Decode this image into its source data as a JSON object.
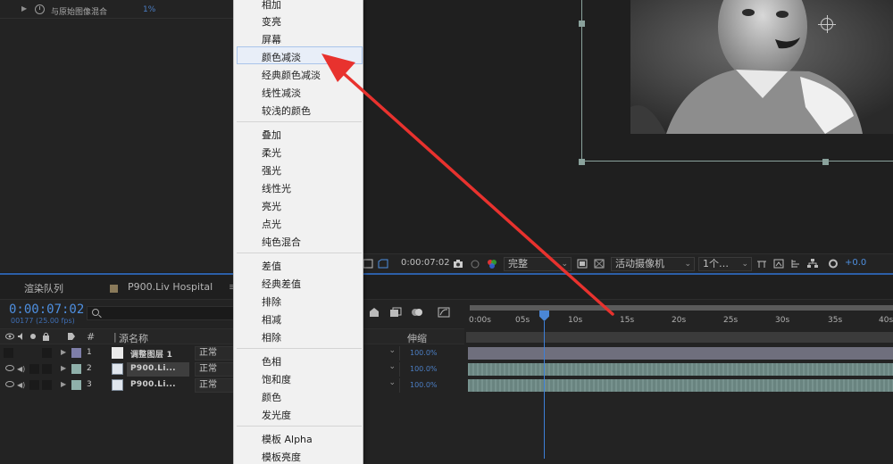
{
  "effects_panel": {
    "property_label": "与原始图像混合",
    "property_value": "1%"
  },
  "viewer_toolbar": {
    "timecode": "0:00:07:02",
    "resolution": "完整",
    "camera": "活动摄像机",
    "views": "1个…",
    "exposure": "+0.0"
  },
  "timeline": {
    "tabs": [
      "渲染队列",
      "P900.Liv Hospital"
    ],
    "timecode": "0:00:07:02",
    "frames": "00177 (25.00 fps)",
    "columns": {
      "hash": "#",
      "source_name": "源名称",
      "stretch": "伸缩"
    },
    "layers": [
      {
        "num": "1",
        "name": "调整图层 1",
        "mode": "正常",
        "stretch": "100.0%",
        "label_color": "#7e7ea8"
      },
      {
        "num": "2",
        "name": "P900.Li...",
        "mode": "正常",
        "stretch": "100.0%",
        "label_color": "#8fb0aa"
      },
      {
        "num": "3",
        "name": "P900.Li...",
        "mode": "正常",
        "stretch": "100.0%",
        "label_color": "#8fb0aa"
      }
    ],
    "ruler_labels": [
      "0:00s",
      "05s",
      "10s",
      "15s",
      "20s",
      "25s",
      "30s",
      "35s",
      "40s"
    ]
  },
  "blend_menu": {
    "items": [
      "相加",
      "变亮",
      "屏幕",
      "颜色减淡",
      "经典颜色减淡",
      "线性减淡",
      "较浅的颜色",
      "叠加",
      "柔光",
      "强光",
      "线性光",
      "亮光",
      "点光",
      "纯色混合",
      "差值",
      "经典差值",
      "排除",
      "相减",
      "相除",
      "色相",
      "饱和度",
      "颜色",
      "发光度",
      "模板 Alpha",
      "模板亮度"
    ],
    "highlighted": "颜色减淡"
  },
  "colors": {
    "accent_blue": "#4e8fe0",
    "annotation_arrow": "#e8322e",
    "menu_bg": "#f1f1f1"
  }
}
